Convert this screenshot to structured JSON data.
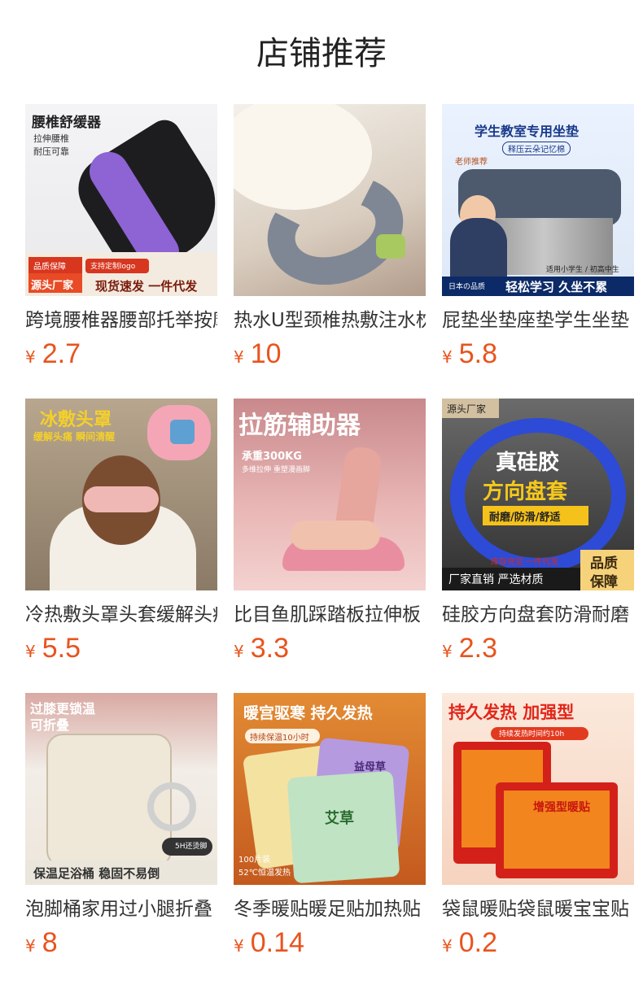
{
  "page": {
    "title": "店铺推荐"
  },
  "products": [
    {
      "name": "跨境腰椎器腰部托举按摩器",
      "currency": "¥",
      "price": "2.7",
      "image": {
        "headline": "腰椎舒缓器",
        "sub1": "拉伸腰椎",
        "sub2": "耐压可靠",
        "tag_a": "品质保障",
        "tag_b": "源头厂家",
        "tag_c": "支持定制logo",
        "bottom": "现货速发 一件代发"
      }
    },
    {
      "name": "热水U型颈椎热敷注水枕",
      "currency": "¥",
      "price": "10",
      "image": {}
    },
    {
      "name": "屁垫坐垫座垫学生坐垫",
      "currency": "¥",
      "price": "5.8",
      "image": {
        "headline": "学生教室专用坐垫",
        "pill": "释压云朵记忆棉",
        "badge": "老师推荐",
        "side": "适用小学生 / 初高中生",
        "bottom_left": "日本の品质",
        "bottom": "轻松学习 久坐不累"
      }
    },
    {
      "name": "冷热敷头罩头套缓解头痛",
      "currency": "¥",
      "price": "5.5",
      "image": {
        "headline": "冰敷头罩",
        "sub": "缓解头痛 瞬间清醒"
      }
    },
    {
      "name": "比目鱼肌踩踏板拉伸板",
      "currency": "¥",
      "price": "3.3",
      "image": {
        "headline": "拉筋辅助器",
        "sub1": "承重300KG",
        "sub2": "多维拉伸 重塑漫画脚"
      }
    },
    {
      "name": "硅胶方向盘套防滑耐磨",
      "currency": "¥",
      "price": "2.3",
      "image": {
        "chip": "源头厂家",
        "headline1": "真硅胶",
        "headline2": "方向盘套",
        "banner": "耐磨/防滑/舒适",
        "stock": "库存充足 一件代发",
        "bottom": "厂家直销 严选材质",
        "badge1": "品质",
        "badge2": "保障"
      }
    },
    {
      "name": "泡脚桶家用过小腿折叠",
      "currency": "¥",
      "price": "8",
      "image": {
        "headline1": "过膝更锁温",
        "headline2": "可折叠",
        "badge": "5H还烫脚",
        "bottom": "保温足浴桶 稳固不易倒"
      }
    },
    {
      "name": "冬季暖贴暖足贴加热贴",
      "currency": "¥",
      "price": "0.14",
      "image": {
        "headline": "暖宫驱寒 持久发热",
        "sub": "持续保温10小时",
        "pack1": "艾草",
        "pack2": "益母草",
        "count": "100片装",
        "temp": "52℃恒温发热"
      }
    },
    {
      "name": "袋鼠暖贴袋鼠暖宝宝贴",
      "currency": "¥",
      "price": "0.2",
      "image": {
        "headline": "持久发热 加强型",
        "sub": "持续发热时间约10h",
        "pkg": "增强型暖贴"
      }
    }
  ]
}
